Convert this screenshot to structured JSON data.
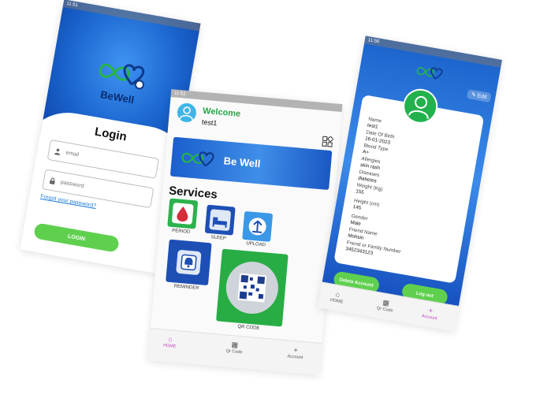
{
  "login": {
    "status_time": "11:51",
    "brand": "BeWell",
    "title": "Login",
    "email_placeholder": "email",
    "password_placeholder": "password",
    "forgot": "Forgot your password?",
    "login_button": "LOGIN"
  },
  "home": {
    "status_time": "11:52",
    "welcome": "Welcome",
    "username": "test1",
    "banner": "Be Well",
    "services_title": "Services",
    "services": [
      {
        "label": "PERIOD",
        "icon": "blood-drop-icon"
      },
      {
        "label": "SLEEP",
        "icon": "bed-icon"
      },
      {
        "label": "UPLOAD",
        "icon": "upload-icon"
      },
      {
        "label": "REMINDER",
        "icon": "bell-icon"
      },
      {
        "label": "QR CODE",
        "icon": "qr-code-icon"
      }
    ],
    "nav": [
      {
        "label": "HOME",
        "icon": "home-icon"
      },
      {
        "label": "Qr Code",
        "icon": "qr-icon"
      },
      {
        "label": "Account",
        "icon": "plus-icon"
      }
    ]
  },
  "account": {
    "status_time": "11:56",
    "edit": "Edit",
    "fields": [
      {
        "label": "Name",
        "value": "test1"
      },
      {
        "label": "Date Of Birth",
        "value": "16-01-2023"
      },
      {
        "label": "Blood Type",
        "value": "A+"
      },
      {
        "label": "Allergies",
        "value": "skin rash"
      },
      {
        "label": "Diseases",
        "value": "diabetes"
      },
      {
        "label": "Weight (Kg)",
        "value": "155"
      },
      {
        "label": "Height (cm)",
        "value": "145"
      },
      {
        "label": "Gender",
        "value": "Male"
      },
      {
        "label": "Friend Name",
        "value": "Mohsin"
      },
      {
        "label": "Friend or Family Number",
        "value": "3452343123"
      }
    ],
    "delete_button": "Delete Account",
    "logout_button": "Log out",
    "nav": [
      {
        "label": "HOME",
        "icon": "home-icon"
      },
      {
        "label": "Qr Code",
        "icon": "qr-icon"
      },
      {
        "label": "Account",
        "icon": "plus-icon"
      }
    ]
  },
  "colors": {
    "blue_dark": "#0d43a8",
    "blue_light": "#3f93f2",
    "green": "#5fd04e",
    "welcome_green": "#26a544",
    "active_nav": "#c642c6"
  }
}
